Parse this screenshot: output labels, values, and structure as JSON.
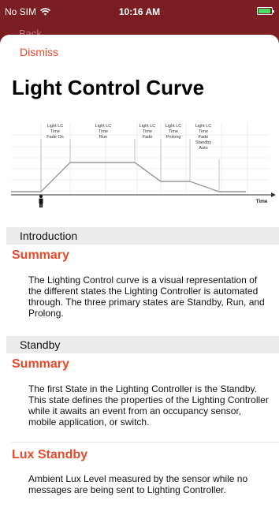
{
  "status": {
    "carrier": "No SIM",
    "time": "10:16 AM"
  },
  "background": {
    "label": "Back"
  },
  "sheet": {
    "dismiss": "Dismiss",
    "title": "Light Control Curve"
  },
  "diagram": {
    "states": [
      [
        "Light LC",
        "Time",
        "Fade On"
      ],
      [
        "Light LC",
        "Time",
        "Run"
      ],
      [
        "Light LC",
        "Time",
        "Fade"
      ],
      [
        "Light LC",
        "Time",
        "Prolong"
      ],
      [
        "Light LC",
        "Time",
        "Fade",
        "Standby",
        "Auto"
      ]
    ],
    "axis_label": "Time",
    "icon": "person-icon"
  },
  "sections": [
    {
      "header": "Introduction",
      "items": [
        {
          "title": "Summary",
          "text": "The Lighting Control curve is a visual representation of the different states the Lighting Controller is automated through. The three primary states are Standby, Run, and Prolong."
        }
      ]
    },
    {
      "header": "Standby",
      "items": [
        {
          "title": "Summary",
          "text": "The first State in the Lighting Controller is the Standby. This state defines the properties of the Lighting Controller while it awaits an event from an occupancy sensor, mobile application, or switch."
        },
        {
          "title": "Lux Standby",
          "text": "Ambient Lux Level measured by the sensor while no messages are being sent to Lighting Controller."
        }
      ]
    }
  ],
  "colors": {
    "accent": "#e8492a",
    "section_bg": "#ececec",
    "sheet_bg": "#ffffff",
    "backdrop": "#7a1e22"
  }
}
